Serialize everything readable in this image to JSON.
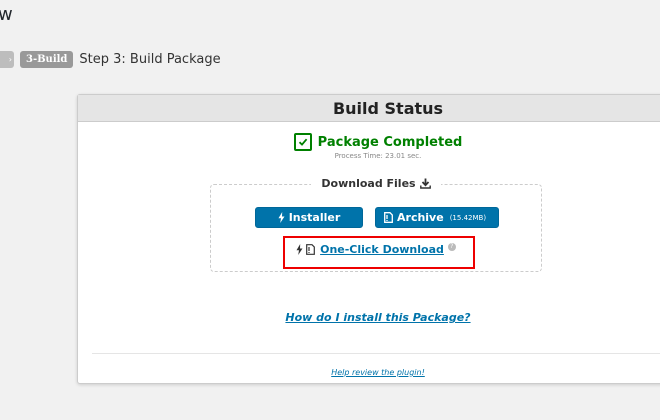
{
  "page": {
    "title": "w"
  },
  "steps": {
    "prev_marker": "›",
    "current_badge": "3-Build",
    "current_label": "Step 3: Build Package"
  },
  "panel": {
    "header": "Build Status",
    "status": "Package Completed",
    "process_time": "Process Time: 23.01 sec.",
    "downloads": {
      "legend": "Download Files",
      "installer_label": "Installer",
      "archive_label": "Archive",
      "archive_size": "(15.42MB)",
      "oneclick_label": "One-Click Download",
      "help_glyph": "?"
    },
    "install_link": "How do I install this Package?",
    "review_link": "Help review the plugin!"
  },
  "colors": {
    "accent": "#0073aa",
    "success": "#008000",
    "highlight": "#ee0000"
  },
  "icons": [
    "check-icon",
    "download-icon",
    "bolt-icon",
    "file-archive-icon",
    "help-icon"
  ]
}
